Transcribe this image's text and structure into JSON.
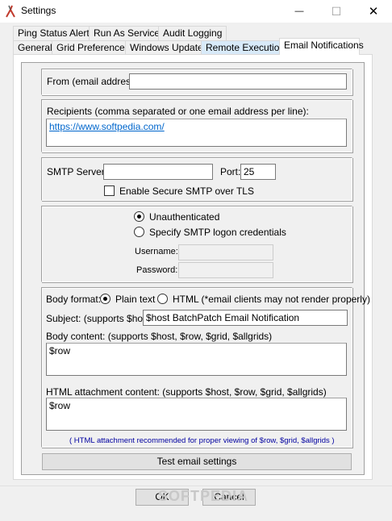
{
  "window": {
    "title": "Settings",
    "icon": "scissors-tool-icon",
    "minimize_glyph": "—",
    "maximize_glyph": "☐",
    "close_glyph": "✕"
  },
  "tabs": {
    "row1": [
      "Ping Status Alerts",
      "Run As Service",
      "Audit Logging"
    ],
    "row2": [
      "General",
      "Grid Preferences",
      "Windows Update",
      "Remote Execution",
      "Email Notifications"
    ],
    "active": "Email Notifications",
    "hover": "Remote Execution"
  },
  "from": {
    "label": "From (email address):",
    "value": ""
  },
  "recipients": {
    "label": "Recipients (comma separated or one email address per line):",
    "value": "https://www.softpedia.com/"
  },
  "smtp": {
    "server_label": "SMTP Server:",
    "server_value": "",
    "port_label": "Port:",
    "port_value": "25",
    "tls_label": "Enable Secure SMTP over TLS",
    "tls_checked": false
  },
  "auth": {
    "unauth_label": "Unauthenticated",
    "specify_label": "Specify SMTP logon credentials",
    "selected": "Unauthenticated",
    "username_label": "Username:",
    "username_value": "",
    "password_label": "Password:",
    "password_value": ""
  },
  "body": {
    "format_label": "Body format:",
    "plain_label": "Plain text",
    "html_label": "HTML (*email clients may not render properly)",
    "selected": "Plain text",
    "subject_label": "Subject: (supports $host)",
    "subject_value": "$host BatchPatch Email Notification",
    "content_label": "Body content: (supports $host, $row, $grid, $allgrids)",
    "content_value": "$row",
    "attachment_label": "HTML attachment content: (supports $host, $row, $grid, $allgrids)",
    "attachment_value": "$row",
    "note": "( HTML attachment recommended for proper viewing of $row, $grid, $allgrids )"
  },
  "buttons": {
    "test": "Test email settings",
    "ok": "OK",
    "cancel": "Cancel"
  },
  "watermark": "SOFTPEDIA"
}
